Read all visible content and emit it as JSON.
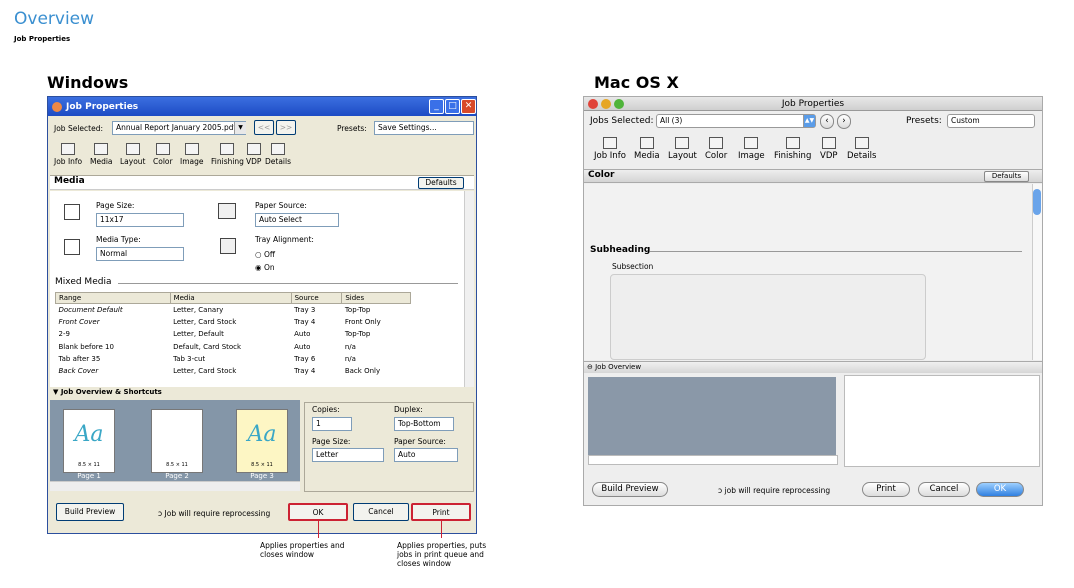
{
  "header": {
    "title": "Overview",
    "subtitle": "Job Properties"
  },
  "windows": {
    "platform_label": "Windows",
    "title": "Job Properties",
    "job_selected_label": "Job Selected:",
    "job_selected_value": "Annual Report January 2005.pdf",
    "nav_prev": "<<",
    "nav_next": ">>",
    "presets_label": "Presets:",
    "presets_value": "Save Settings...",
    "toolbar": [
      "Job Info",
      "Media",
      "Layout",
      "Color",
      "Image",
      "Finishing",
      "VDP",
      "Details"
    ],
    "section_title": "Media",
    "defaults_label": "Defaults",
    "page_size_label": "Page Size:",
    "page_size_value": "11x17",
    "media_type_label": "Media Type:",
    "media_type_value": "Normal",
    "paper_source_label": "Paper Source:",
    "paper_source_value": "Auto Select",
    "tray_alignment_label": "Tray Alignment:",
    "tray_off": "Off",
    "tray_on": "On",
    "mixed_media_title": "Mixed Media",
    "mixed_media_columns": [
      "Range",
      "Media",
      "Source",
      "Sides"
    ],
    "mixed_media_rows": [
      [
        "Document Default",
        "Letter, Canary",
        "Tray 3",
        "Top-Top"
      ],
      [
        "Front Cover",
        "Letter, Card Stock",
        "Tray 4",
        "Front Only"
      ],
      [
        "2-9",
        "Letter, Default",
        "Auto",
        "Top-Top"
      ],
      [
        "Blank before 10",
        "Default, Card Stock",
        "Auto",
        "n/a"
      ],
      [
        "Tab after 35",
        "Tab 3-cut",
        "Tray 6",
        "n/a"
      ],
      [
        "Back Cover",
        "Letter, Card Stock",
        "Tray 4",
        "Back Only"
      ]
    ],
    "overview_title": "Job Overview & Shortcuts",
    "pages": [
      {
        "glyph": "Aa",
        "size": "8.5 × 11",
        "label": "Page 1"
      },
      {
        "glyph": "",
        "size": "8.5 × 11",
        "label": "Page 2"
      },
      {
        "glyph": "Aa",
        "size": "8.5 × 11",
        "label": "Page 3"
      }
    ],
    "copies_label": "Copies:",
    "copies_value": "1",
    "duplex_label": "Duplex:",
    "duplex_value": "Top-Bottom",
    "short_page_size_label": "Page Size:",
    "short_page_size_value": "Letter",
    "short_paper_source_label": "Paper Source:",
    "short_paper_source_value": "Auto",
    "build_preview": "Build Preview",
    "reprocess_note": "Job will require reprocessing",
    "ok": "OK",
    "cancel": "Cancel",
    "print": "Print",
    "caption_ok": "Applies properties and closes window",
    "caption_print": "Applies properties, puts jobs in print queue and closes window"
  },
  "mac": {
    "platform_label": "Mac OS X",
    "title": "Job Properties",
    "jobs_selected_label": "Jobs Selected:",
    "jobs_selected_value": "All (3)",
    "presets_label": "Presets:",
    "presets_value": "Custom",
    "toolbar": [
      "Job Info",
      "Media",
      "Layout",
      "Color",
      "Image",
      "Finishing",
      "VDP",
      "Details"
    ],
    "section_title": "Color",
    "defaults_label": "Defaults",
    "subheading": "Subheading",
    "subsection": "Subsection",
    "overview_title": "Job Overview",
    "build_preview": "Build Preview",
    "reprocess_note": "job will require reprocessing",
    "print": "Print",
    "cancel": "Cancel",
    "ok": "OK"
  }
}
